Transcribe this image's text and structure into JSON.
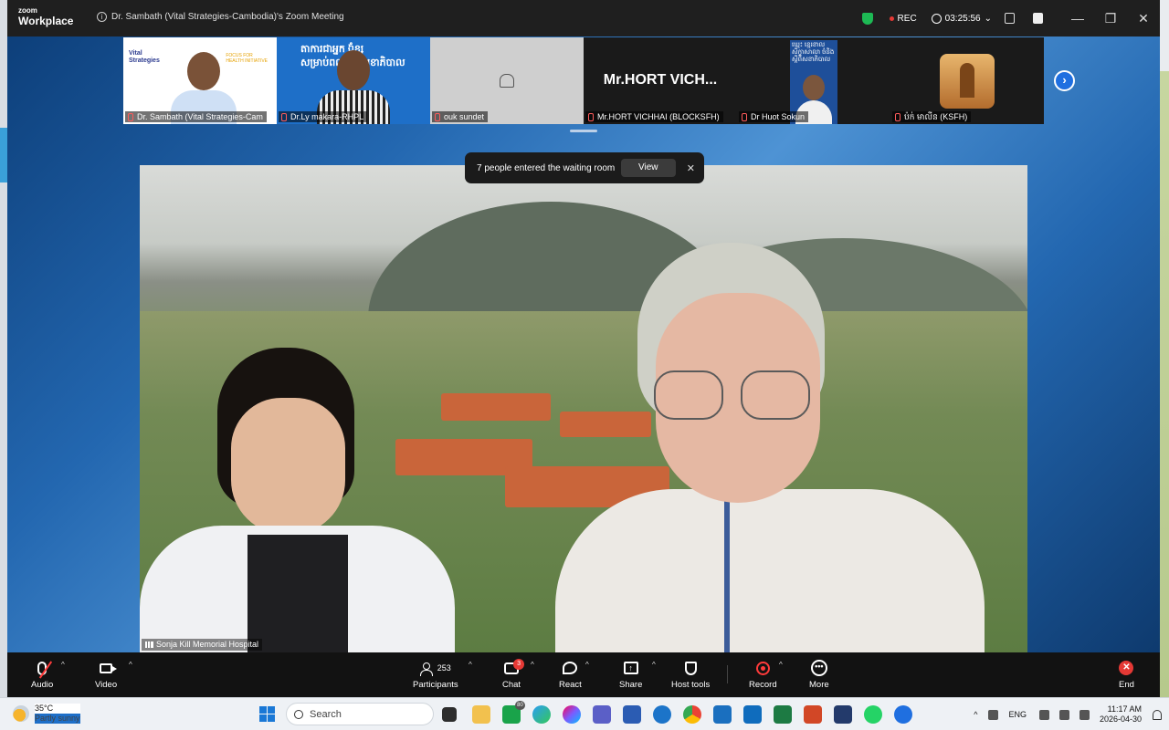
{
  "window": {
    "logo_line1": "zoom",
    "logo_line2": "Workplace",
    "title": "Dr. Sambath (Vital Strategies-Cambodia)'s Zoom Meeting",
    "rec_label": "REC",
    "timer": "03:25:56",
    "controls": [
      "—",
      "❐",
      "✕"
    ]
  },
  "participants_strip": [
    {
      "name": "Dr. Sambath (Vital Strategies-Cam",
      "logo_text": "Vital\nStrategies",
      "partner_text": "FOCUS FOR\nHEALTH INITIATIVE"
    },
    {
      "name": "Dr.Ly makara-RHPL",
      "bg_text": "តាការជាអ្នក ឯំខ្ស ឲសាកុងគួន\nសម្រាប់ពលរ ស្ថសុខាភិបាល"
    },
    {
      "name": "ouk sundet"
    },
    {
      "name": "Mr.HORT VICHHAI (BLOCKSFH)",
      "big_text": "Mr.HORT  VICH..."
    },
    {
      "name": "Dr Huot Sokun",
      "poster_text": "ឃ្មេះ ខ្មេរខាល\nសិក្ខាសាលា ចំនិង\nស្ដីពីសខាភិបាល"
    },
    {
      "name": "ប៉ក់ មាលីន (KSFH)"
    }
  ],
  "notification": {
    "text": "7 people entered the waiting room",
    "view_label": "View",
    "close_label": "✕"
  },
  "main_video": {
    "label": "Sonja Kill Memorial Hospital"
  },
  "toolbar": {
    "audio": "Audio",
    "video": "Video",
    "participants": "Participants",
    "participants_count": "253",
    "chat": "Chat",
    "chat_badge": "3",
    "react": "React",
    "share": "Share",
    "host_tools": "Host tools",
    "record": "Record",
    "more": "More",
    "more_glyph": "•••",
    "end": "End",
    "end_glyph": "✕",
    "caret": "^"
  },
  "taskbar": {
    "temperature": "35°C",
    "weather": "Partly sunny",
    "search_placeholder": "Search",
    "edge_badge": "80",
    "lang": "ENG",
    "time": "11:17 AM",
    "date": "2026-04-30",
    "tray_caret": "^"
  },
  "colors": {
    "accent": "#1f6fe0",
    "record": "#ff3b3b",
    "end": "#e53935",
    "shield": "#1db954"
  }
}
